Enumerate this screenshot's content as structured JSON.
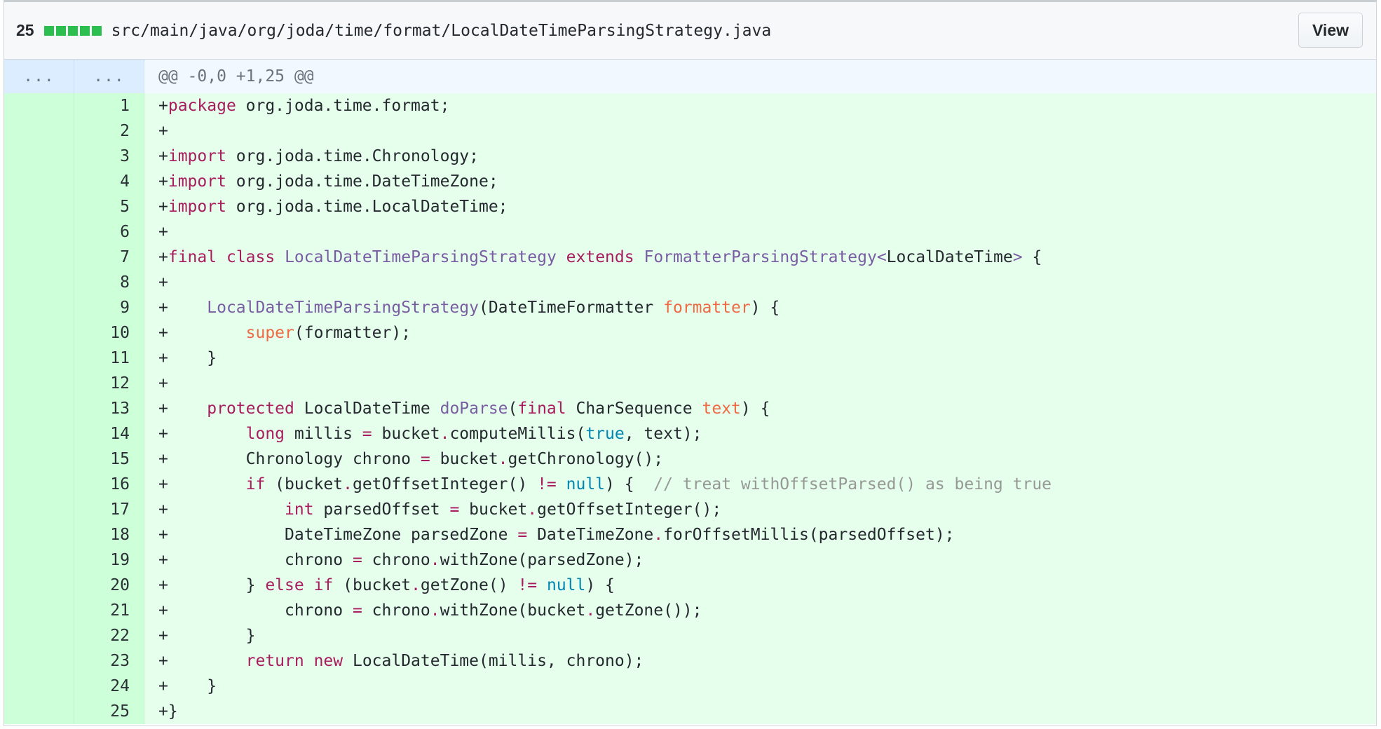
{
  "file": {
    "additions_count": "25",
    "diffstat_blocks": 5,
    "diffstat_color": "#2cbe4e",
    "path": "src/main/java/org/joda/time/format/LocalDateTimeParsingStrategy.java",
    "view_label": "View"
  },
  "hunk": {
    "old_marker": "...",
    "new_marker": "...",
    "header": "@@ -0,0 +1,25 @@"
  },
  "colors": {
    "addition_background": "#e6ffed",
    "addition_gutter": "#cdffd8",
    "hunk_background": "#f1f8ff",
    "keyword": "#a71d5d",
    "entity": "#795da3",
    "parameter": "#ed6a43",
    "constant": "#0086b3",
    "comment": "#969896"
  },
  "lines": [
    {
      "num": "1",
      "tokens": [
        [
          "",
          "+"
        ],
        [
          "kw",
          "package"
        ],
        [
          "",
          " org.joda.time.format;"
        ]
      ]
    },
    {
      "num": "2",
      "tokens": [
        [
          "",
          "+"
        ]
      ]
    },
    {
      "num": "3",
      "tokens": [
        [
          "",
          "+"
        ],
        [
          "kw",
          "import"
        ],
        [
          "",
          " org.joda.time.Chronology;"
        ]
      ]
    },
    {
      "num": "4",
      "tokens": [
        [
          "",
          "+"
        ],
        [
          "kw",
          "import"
        ],
        [
          "",
          " org.joda.time.DateTimeZone;"
        ]
      ]
    },
    {
      "num": "5",
      "tokens": [
        [
          "",
          "+"
        ],
        [
          "kw",
          "import"
        ],
        [
          "",
          " org.joda.time.LocalDateTime;"
        ]
      ]
    },
    {
      "num": "6",
      "tokens": [
        [
          "",
          "+"
        ]
      ]
    },
    {
      "num": "7",
      "tokens": [
        [
          "",
          "+"
        ],
        [
          "kw",
          "final"
        ],
        [
          "",
          " "
        ],
        [
          "kw",
          "class"
        ],
        [
          "",
          " "
        ],
        [
          "en",
          "LocalDateTimeParsingStrategy"
        ],
        [
          "",
          " "
        ],
        [
          "kw",
          "extends"
        ],
        [
          "",
          " "
        ],
        [
          "en",
          "FormatterParsingStrategy"
        ],
        [
          "sp",
          "<"
        ],
        [
          "",
          "LocalDateTime"
        ],
        [
          "sp",
          ">"
        ],
        [
          "",
          " {"
        ]
      ]
    },
    {
      "num": "8",
      "tokens": [
        [
          "",
          "+"
        ]
      ]
    },
    {
      "num": "9",
      "tokens": [
        [
          "",
          "+    "
        ],
        [
          "en",
          "LocalDateTimeParsingStrategy"
        ],
        [
          "",
          "(DateTimeFormatter "
        ],
        [
          "pm",
          "formatter"
        ],
        [
          "",
          ") {"
        ]
      ]
    },
    {
      "num": "10",
      "tokens": [
        [
          "",
          "+        "
        ],
        [
          "pm",
          "super"
        ],
        [
          "",
          "(formatter);"
        ]
      ]
    },
    {
      "num": "11",
      "tokens": [
        [
          "",
          "+    }"
        ]
      ]
    },
    {
      "num": "12",
      "tokens": [
        [
          "",
          "+"
        ]
      ]
    },
    {
      "num": "13",
      "tokens": [
        [
          "",
          "+    "
        ],
        [
          "kw",
          "protected"
        ],
        [
          "",
          " LocalDateTime "
        ],
        [
          "en",
          "doParse"
        ],
        [
          "",
          "("
        ],
        [
          "kw",
          "final"
        ],
        [
          "",
          " CharSequence "
        ],
        [
          "pm",
          "text"
        ],
        [
          "",
          ") {"
        ]
      ]
    },
    {
      "num": "14",
      "tokens": [
        [
          "",
          "+        "
        ],
        [
          "kw",
          "long"
        ],
        [
          "",
          " millis "
        ],
        [
          "op",
          "="
        ],
        [
          "",
          " bucket"
        ],
        [
          "op",
          "."
        ],
        [
          "",
          "computeMillis("
        ],
        [
          "cn",
          "true"
        ],
        [
          "",
          ", text);"
        ]
      ]
    },
    {
      "num": "15",
      "tokens": [
        [
          "",
          "+        Chronology chrono "
        ],
        [
          "op",
          "="
        ],
        [
          "",
          " bucket"
        ],
        [
          "op",
          "."
        ],
        [
          "",
          "getChronology();"
        ]
      ]
    },
    {
      "num": "16",
      "tokens": [
        [
          "",
          "+        "
        ],
        [
          "kw",
          "if"
        ],
        [
          "",
          " (bucket"
        ],
        [
          "op",
          "."
        ],
        [
          "",
          "getOffsetInteger() "
        ],
        [
          "op",
          "!="
        ],
        [
          "",
          " "
        ],
        [
          "cn",
          "null"
        ],
        [
          "",
          ") {  "
        ],
        [
          "cm",
          "// treat withOffsetParsed() as being true"
        ]
      ]
    },
    {
      "num": "17",
      "tokens": [
        [
          "",
          "+            "
        ],
        [
          "kw",
          "int"
        ],
        [
          "",
          " parsedOffset "
        ],
        [
          "op",
          "="
        ],
        [
          "",
          " bucket"
        ],
        [
          "op",
          "."
        ],
        [
          "",
          "getOffsetInteger();"
        ]
      ]
    },
    {
      "num": "18",
      "tokens": [
        [
          "",
          "+            DateTimeZone parsedZone "
        ],
        [
          "op",
          "="
        ],
        [
          "",
          " DateTimeZone"
        ],
        [
          "op",
          "."
        ],
        [
          "",
          "forOffsetMillis(parsedOffset);"
        ]
      ]
    },
    {
      "num": "19",
      "tokens": [
        [
          "",
          "+            chrono "
        ],
        [
          "op",
          "="
        ],
        [
          "",
          " chrono"
        ],
        [
          "op",
          "."
        ],
        [
          "",
          "withZone(parsedZone);"
        ]
      ]
    },
    {
      "num": "20",
      "tokens": [
        [
          "",
          "+        } "
        ],
        [
          "kw",
          "else"
        ],
        [
          "",
          " "
        ],
        [
          "kw",
          "if"
        ],
        [
          "",
          " (bucket"
        ],
        [
          "op",
          "."
        ],
        [
          "",
          "getZone() "
        ],
        [
          "op",
          "!="
        ],
        [
          "",
          " "
        ],
        [
          "cn",
          "null"
        ],
        [
          "",
          ") {"
        ]
      ]
    },
    {
      "num": "21",
      "tokens": [
        [
          "",
          "+            chrono "
        ],
        [
          "op",
          "="
        ],
        [
          "",
          " chrono"
        ],
        [
          "op",
          "."
        ],
        [
          "",
          "withZone(bucket"
        ],
        [
          "op",
          "."
        ],
        [
          "",
          "getZone());"
        ]
      ]
    },
    {
      "num": "22",
      "tokens": [
        [
          "",
          "+        }"
        ]
      ]
    },
    {
      "num": "23",
      "tokens": [
        [
          "",
          "+        "
        ],
        [
          "kw",
          "return"
        ],
        [
          "",
          " "
        ],
        [
          "kw",
          "new"
        ],
        [
          "",
          " LocalDateTime(millis, chrono);"
        ]
      ]
    },
    {
      "num": "24",
      "tokens": [
        [
          "",
          "+    }"
        ]
      ]
    },
    {
      "num": "25",
      "tokens": [
        [
          "",
          "+}"
        ]
      ]
    }
  ]
}
